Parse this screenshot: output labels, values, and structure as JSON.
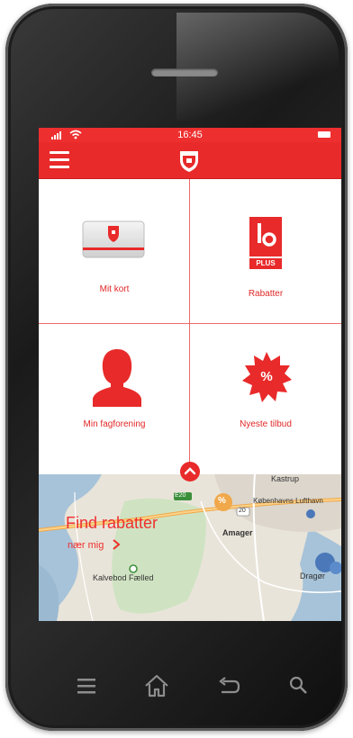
{
  "statusbar": {
    "time": "16:45"
  },
  "appbar": {
    "menu_icon": "hamburger-menu-icon",
    "logo_icon": "shield-logo-icon"
  },
  "tiles": [
    {
      "label": "Mit kort",
      "icon": "member-card-icon"
    },
    {
      "label": "Rabatter",
      "icon": "lo-plus-logo-icon",
      "logo_text": "PLUS"
    },
    {
      "label": "Min fagforening",
      "icon": "person-icon"
    },
    {
      "label": "Nyeste tilbud",
      "icon": "percent-badge-icon",
      "badge_text": "%"
    }
  ],
  "map": {
    "title": "Find rabatter",
    "subtitle": "nær mig",
    "places": [
      "Kastrup",
      "Københavns Lufthavn",
      "Amager",
      "Kalvebod Fælled",
      "Dragør"
    ],
    "road_numbers": [
      "E20",
      "20"
    ],
    "poi_marker": "%"
  },
  "colors": {
    "brand_red": "#e82a2a",
    "map_bg": "#e9e4d9",
    "water": "#a7c3d9",
    "park": "#cfe3c2"
  },
  "navbar": {
    "icons": [
      "menu-icon",
      "home-icon",
      "back-icon",
      "search-icon"
    ]
  }
}
